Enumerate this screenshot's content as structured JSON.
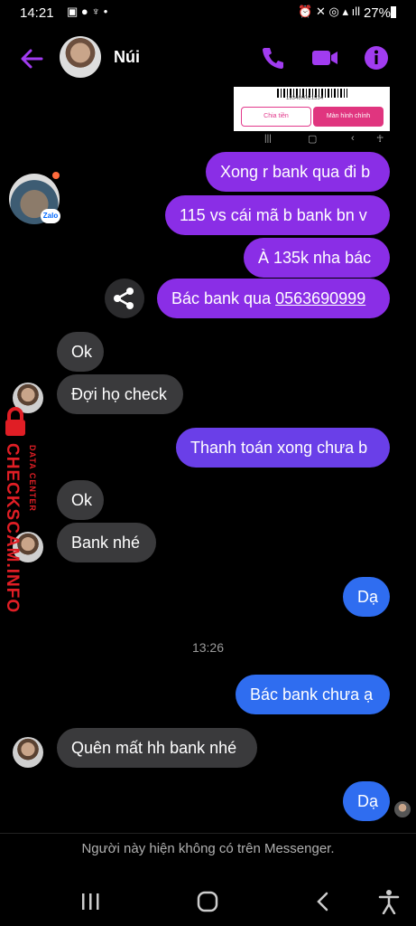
{
  "status_bar": {
    "time": "14:21",
    "battery": "27%"
  },
  "header": {
    "contact_name": "Núi"
  },
  "shared_image": {
    "btn_left": "Chia tiền",
    "btn_right": "Màn hình chính",
    "barcode_text": "1934600C1534"
  },
  "messages": [
    {
      "text": "Xong r bank qua đi b"
    },
    {
      "text": "115 vs cái mã b bank bn v"
    },
    {
      "text": "À 135k nha bác"
    },
    {
      "text_prefix": "Bác bank qua ",
      "text_link": "0563690999"
    },
    {
      "text": "Ok"
    },
    {
      "text": "Đợi họ check"
    },
    {
      "text": "Thanh toán xong chưa b"
    },
    {
      "text": "Ok"
    },
    {
      "text": "Bank nhé"
    },
    {
      "text": "Dạ"
    },
    {
      "text": "Bác bank chưa ạ"
    },
    {
      "text": "Quên mất hh bank nhé"
    },
    {
      "text": "Dạ"
    }
  ],
  "timestamp": "13:26",
  "group_badge": "Zalo",
  "footer_note": "Người này hiện không có trên Messenger.",
  "watermark": {
    "brand": "CHECKSCAM.INFO",
    "sub": "DATA CENTER"
  },
  "colors": {
    "accent": "#8a2ee6",
    "blue_bubble": "#2f6df0",
    "incoming": "#3a3a3c"
  }
}
